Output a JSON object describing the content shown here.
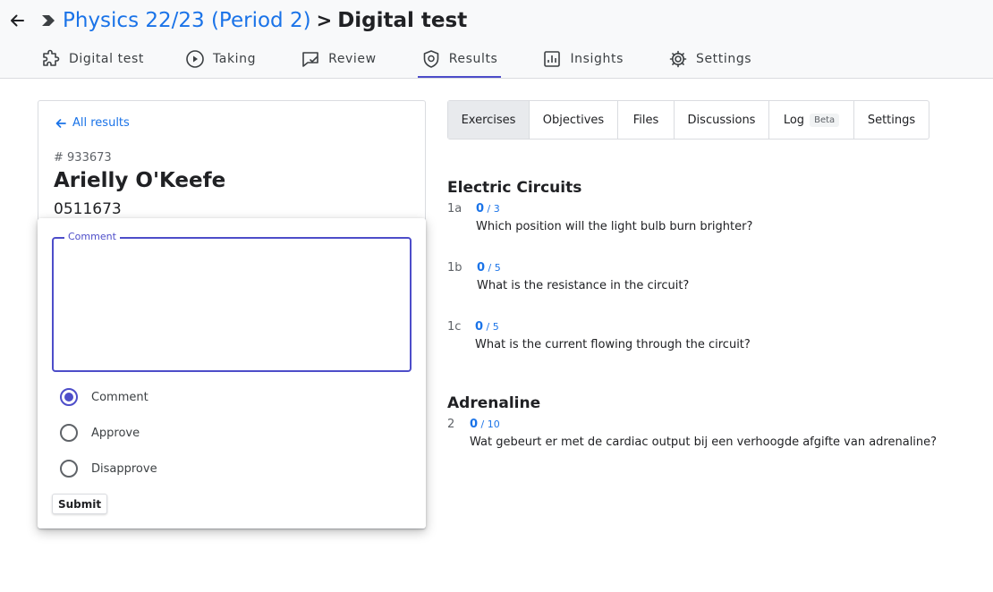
{
  "header": {
    "breadcrumb_course": "Physics 22/23 (Period 2)",
    "breadcrumb_separator": ">",
    "breadcrumb_current": "Digital test"
  },
  "nav": {
    "tabs": [
      {
        "label": "Digital test",
        "icon": "puzzle-icon"
      },
      {
        "label": "Taking",
        "icon": "play-circle-icon"
      },
      {
        "label": "Review",
        "icon": "comment-check-icon"
      },
      {
        "label": "Results",
        "icon": "shield-icon",
        "active": true
      },
      {
        "label": "Insights",
        "icon": "chart-icon"
      },
      {
        "label": "Settings",
        "icon": "gear-icon"
      }
    ]
  },
  "student": {
    "back_label": "All results",
    "number": "# 933673",
    "name": "Arielly O'Keefe",
    "code": "0511673"
  },
  "popup": {
    "comment_label": "Comment",
    "comment_value": "",
    "options": [
      {
        "label": "Comment",
        "checked": true
      },
      {
        "label": "Approve",
        "checked": false
      },
      {
        "label": "Disapprove",
        "checked": false
      }
    ],
    "submit_label": "Submit"
  },
  "subtabs": {
    "items": [
      {
        "label": "Exercises",
        "active": true
      },
      {
        "label": "Objectives"
      },
      {
        "label": "Files"
      },
      {
        "label": "Discussions"
      },
      {
        "label": "Log",
        "badge": "Beta"
      },
      {
        "label": "Settings"
      }
    ]
  },
  "sections": [
    {
      "title": "Electric Circuits",
      "exercises": [
        {
          "num": "1a",
          "score": "0",
          "max": " / 3",
          "question": "Which position will the light bulb burn brighter?"
        },
        {
          "num": "1b",
          "score": "0",
          "max": " / 5",
          "question": "What is the resistance in the circuit?"
        },
        {
          "num": "1c",
          "score": "0",
          "max": " / 5",
          "question": "What is the current flowing through the circuit?"
        }
      ]
    },
    {
      "title": "Adrenaline",
      "exercises": [
        {
          "num": "2",
          "score": "0",
          "max": " / 10",
          "question": "Wat gebeurt er met de cardiac output bij een verhoogde afgifte van adrenaline?"
        }
      ]
    }
  ],
  "colors": {
    "accent": "#4d4dc9",
    "link": "#1a73e8"
  }
}
